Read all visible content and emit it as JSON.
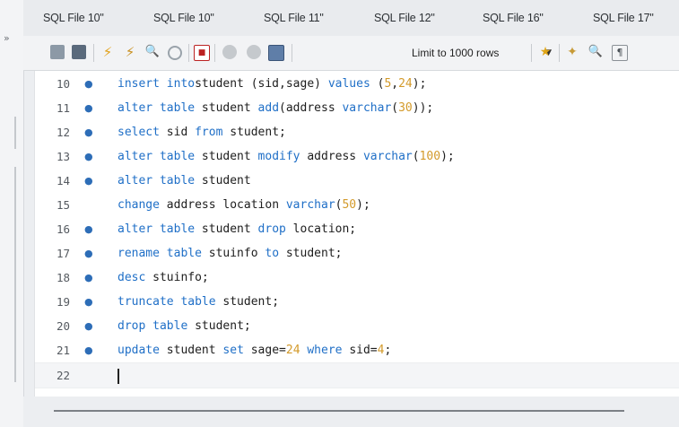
{
  "tabs": [
    "SQL File 10\"",
    "SQL File 10\"",
    "SQL File 11\"",
    "SQL File 12\"",
    "SQL File 16\"",
    "SQL File 17\""
  ],
  "toolbar": {
    "limit_label": "Limit to 1000 rows",
    "icons": [
      "open-folder-icon",
      "save-icon",
      "execute-icon",
      "execute-current-icon",
      "explain-icon",
      "stop-icon",
      "toggle-error-icon",
      "commit-icon",
      "rollback-icon",
      "autocommit-icon",
      "bookmark-star-icon",
      "beautify-icon",
      "find-icon",
      "invisible-chars-icon"
    ]
  },
  "editor": {
    "lines": [
      {
        "n": "10",
        "dot": true,
        "tokens": [
          [
            "kw",
            "insert into"
          ],
          [
            "",
            "student (sid,sage) "
          ],
          [
            "kw",
            "values"
          ],
          [
            "",
            " ("
          ],
          [
            "num",
            "5"
          ],
          [
            "",
            ","
          ],
          [
            "num",
            "24"
          ],
          [
            "",
            ");"
          ]
        ]
      },
      {
        "n": "11",
        "dot": true,
        "tokens": [
          [
            "kw",
            "alter table"
          ],
          [
            "",
            " student "
          ],
          [
            "kw",
            "add"
          ],
          [
            "",
            "(address "
          ],
          [
            "kw",
            "varchar"
          ],
          [
            "",
            "("
          ],
          [
            "num",
            "30"
          ],
          [
            "",
            "));"
          ]
        ]
      },
      {
        "n": "12",
        "dot": true,
        "tokens": [
          [
            "kw",
            "select"
          ],
          [
            "",
            " sid "
          ],
          [
            "kw",
            "from"
          ],
          [
            "",
            " student;"
          ]
        ]
      },
      {
        "n": "13",
        "dot": true,
        "tokens": [
          [
            "kw",
            "alter table"
          ],
          [
            "",
            " student "
          ],
          [
            "kw",
            "modify"
          ],
          [
            "",
            " address "
          ],
          [
            "kw",
            "varchar"
          ],
          [
            "",
            "("
          ],
          [
            "num",
            "100"
          ],
          [
            "",
            ");"
          ]
        ]
      },
      {
        "n": "14",
        "dot": true,
        "tokens": [
          [
            "kw",
            "alter table"
          ],
          [
            "",
            " student"
          ]
        ]
      },
      {
        "n": "15",
        "dot": false,
        "tokens": [
          [
            "kw",
            "change"
          ],
          [
            "",
            " address location "
          ],
          [
            "kw",
            "varchar"
          ],
          [
            "",
            "("
          ],
          [
            "num",
            "50"
          ],
          [
            "",
            ");"
          ]
        ]
      },
      {
        "n": "16",
        "dot": true,
        "tokens": [
          [
            "kw",
            "alter table"
          ],
          [
            "",
            " student "
          ],
          [
            "kw",
            "drop"
          ],
          [
            "",
            " location;"
          ]
        ]
      },
      {
        "n": "17",
        "dot": true,
        "tokens": [
          [
            "kw",
            "rename table"
          ],
          [
            "",
            " stuinfo "
          ],
          [
            "kw",
            "to"
          ],
          [
            "",
            " student;"
          ]
        ]
      },
      {
        "n": "18",
        "dot": true,
        "tokens": [
          [
            "kw",
            "desc"
          ],
          [
            "",
            " stuinfo;"
          ]
        ]
      },
      {
        "n": "19",
        "dot": true,
        "tokens": [
          [
            "kw",
            "truncate table"
          ],
          [
            "",
            " student;"
          ]
        ]
      },
      {
        "n": "20",
        "dot": true,
        "tokens": [
          [
            "kw",
            "drop table"
          ],
          [
            "",
            " student;"
          ]
        ]
      },
      {
        "n": "21",
        "dot": true,
        "tokens": [
          [
            "kw",
            "update"
          ],
          [
            "",
            " student "
          ],
          [
            "kw",
            "set"
          ],
          [
            "",
            " sage="
          ],
          [
            "num",
            "24"
          ],
          [
            "",
            " "
          ],
          [
            "kw",
            "where"
          ],
          [
            "",
            " sid="
          ],
          [
            "num",
            "4"
          ],
          [
            "",
            ";"
          ]
        ]
      },
      {
        "n": "22",
        "dot": false,
        "tokens": []
      }
    ],
    "current_line": "22",
    "dot_glyph": "●",
    "keyword_color": "#1f6fc7",
    "number_color": "#d39a2a"
  }
}
